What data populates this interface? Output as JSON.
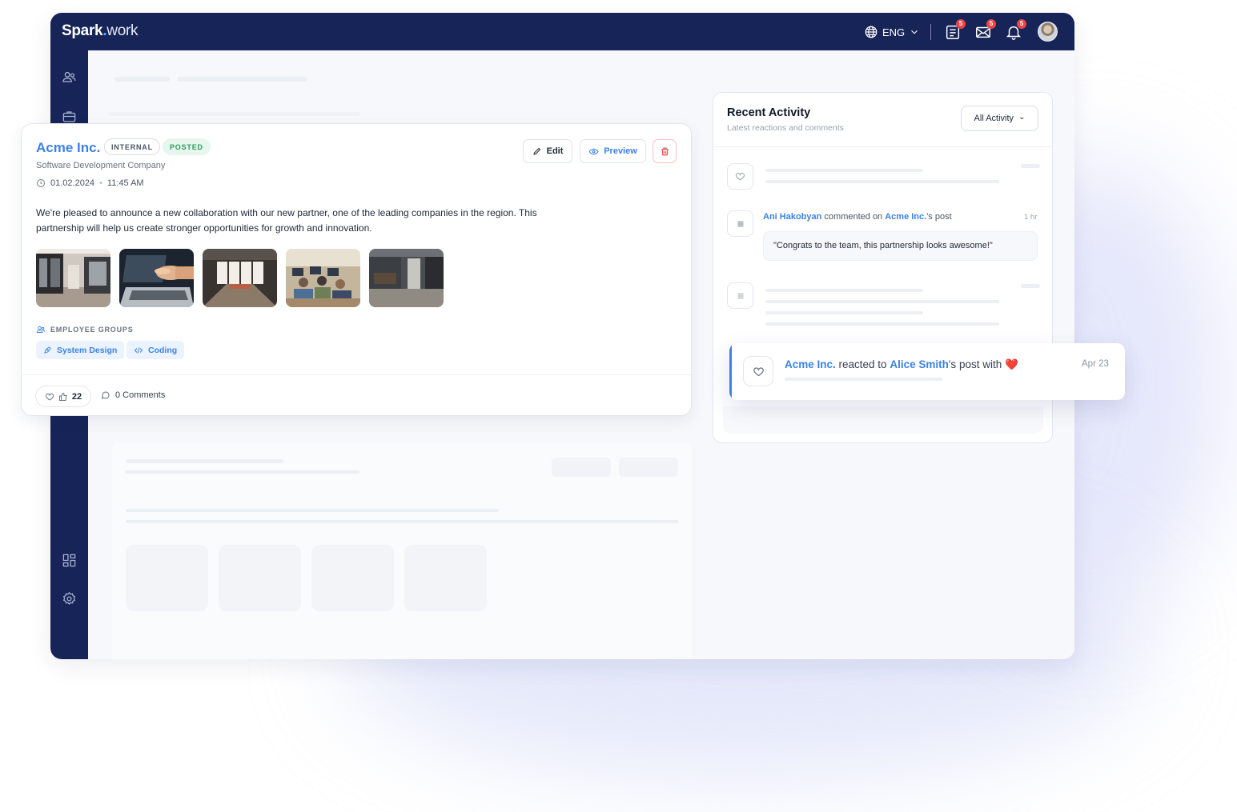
{
  "app": {
    "logo_bold": "Spark",
    "logo_dot": ".",
    "logo_light": "work"
  },
  "header": {
    "language": "ENG",
    "tasks_badge": "5",
    "messages_badge": "5",
    "notifications_badge": "5"
  },
  "post": {
    "company": "Acme Inc.",
    "visibility_tag": "INTERNAL",
    "status_tag": "POSTED",
    "subtitle": "Software Development Company",
    "date": "01.02.2024",
    "separator": "•",
    "time": "11:45 AM",
    "body": "We're pleased to announce a new collaboration with our new partner, one of the leading companies in the region. This partnership will help us create stronger opportunities for growth and innovation.",
    "edit_label": "Edit",
    "preview_label": "Preview",
    "groups_label": "EMPLOYEE GROUPS",
    "groups": [
      "System Design",
      "Coding"
    ],
    "likes_count": "22",
    "comments_label": "0 Comments"
  },
  "activity": {
    "title": "Recent Activity",
    "subtitle": "Latest reactions and comments",
    "filter_label": "All Activity",
    "filter_chevron": "⌄",
    "comment_author": "Ani Hakobyan",
    "comment_mid": " commented on ",
    "comment_target": "Acme Inc.",
    "comment_end": "'s post",
    "comment_time": "1 hr",
    "comment_text": "\"Congrats to the team, this partnership looks awesome!\""
  },
  "notification": {
    "actor": "Acme Inc.",
    "mid": " reacted to ",
    "target": "Alice Smith",
    "end": "'s post with ",
    "emoji": "❤️",
    "date": "Apr 23"
  },
  "colors": {
    "navy": "#162457",
    "accent_blue": "#3b82e8",
    "posted_green": "#2f9a5b",
    "badge_red": "#ef4444"
  },
  "icons": {
    "globe": "globe-icon",
    "tasks": "tasks-icon",
    "mail": "mail-icon",
    "bell": "bell-icon",
    "users": "users-icon",
    "briefcase": "briefcase-icon",
    "grid": "grid-icon",
    "settings": "gear-icon",
    "heart": "heart-icon",
    "list": "list-icon"
  }
}
